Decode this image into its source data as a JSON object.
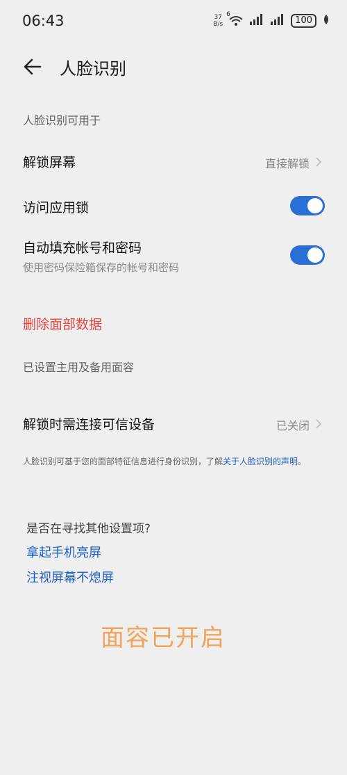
{
  "status": {
    "time": "06:43",
    "net_speed_value": "37",
    "net_speed_unit": "B/s",
    "wifi_badge": "6",
    "battery": "100"
  },
  "header": {
    "title": "人脸识别"
  },
  "section": {
    "label": "人脸识别可用于"
  },
  "rows": {
    "unlock_screen": {
      "title": "解锁屏幕",
      "value": "直接解锁"
    },
    "app_lock": {
      "title": "访问应用锁",
      "toggle": "on"
    },
    "autofill": {
      "title": "自动填充帐号和密码",
      "subtitle": "使用密码保险箱保存的帐号和密码",
      "toggle": "on"
    }
  },
  "delete_face_data": "删除面部数据",
  "face_status": "已设置主用及备用面容",
  "trusted_device": {
    "title": "解锁时需连接可信设备",
    "value": "已关闭"
  },
  "footnote": {
    "text": "人脸识别可基于您的面部特征信息进行身份识别，了解",
    "link": "关于人脸识别的声明",
    "end": "。"
  },
  "suggest": {
    "question": "是否在寻找其他设置项?",
    "link1": "拿起手机亮屏",
    "link2": "注视屏幕不熄屏"
  },
  "overlay": "面容已开启",
  "colors": {
    "accent": "#2a6fd6",
    "danger": "#e04545",
    "link": "#1e5fc4",
    "overlay": "#f2a35c"
  }
}
